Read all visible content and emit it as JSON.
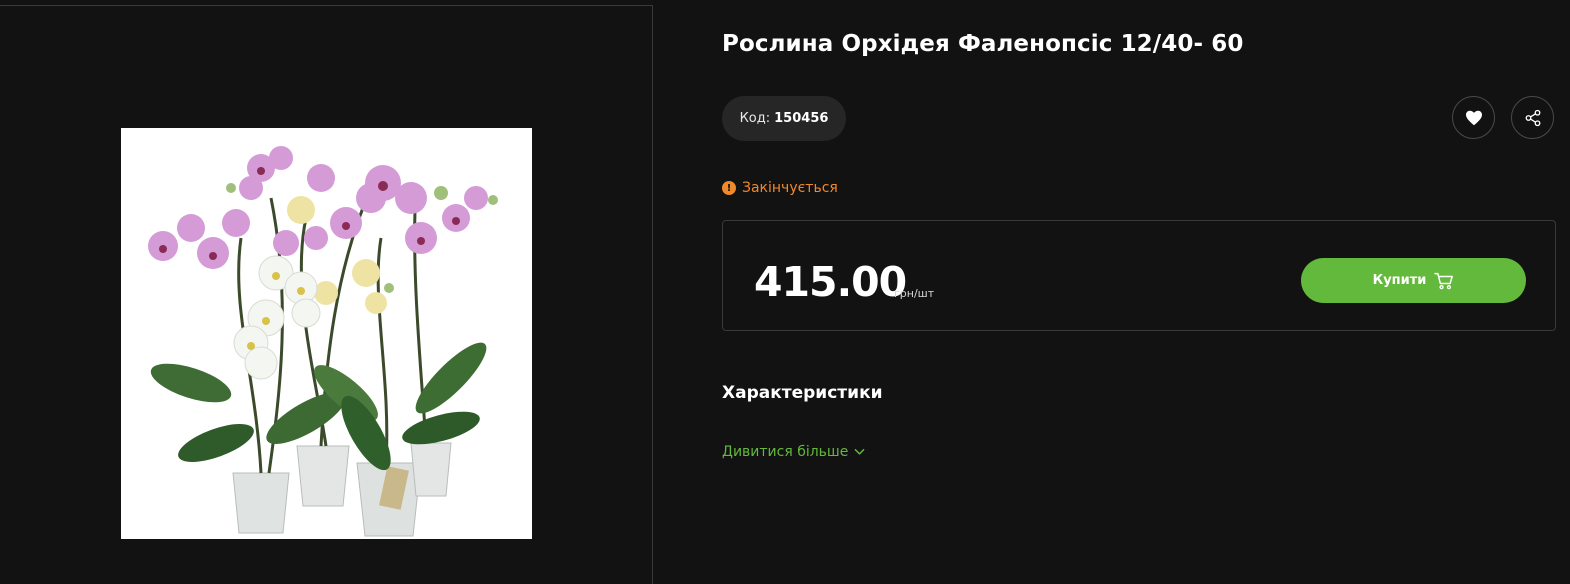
{
  "product": {
    "title": "Рослина Орхідея Фаленопсіс 12/40- 60",
    "image_alt": "Орхідея Фаленопсіс",
    "code_label": "Код:",
    "code_value": "150456",
    "stock_status": "Закінчується",
    "price": "415.00",
    "price_unit": "грн/шт",
    "buy_label": "Купити"
  },
  "characteristics": {
    "heading": "Характеристики",
    "see_more": "Дивитися більше"
  },
  "icons": {
    "favorite": "heart-icon",
    "share": "share-icon",
    "warning": "warning-icon",
    "cart": "cart-icon",
    "chevron": "chevron-down-icon"
  },
  "colors": {
    "background": "#121212",
    "accent_green": "#63b93b",
    "warning_orange": "#f0892a",
    "pill_bg": "#262626",
    "border": "#3a3a3a"
  }
}
